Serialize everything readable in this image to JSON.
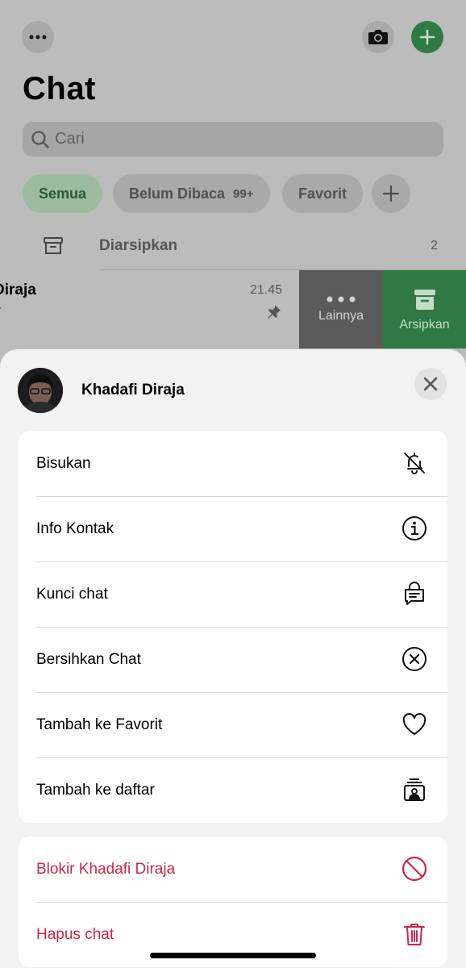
{
  "header": {
    "title": "Chat"
  },
  "search": {
    "placeholder": "Cari"
  },
  "filters": [
    {
      "label": "Semua",
      "active": true
    },
    {
      "label": "Belum Dibaca",
      "count": "99+"
    },
    {
      "label": "Favorit"
    }
  ],
  "archived": {
    "label": "Diarsipkan",
    "count": "2"
  },
  "chat": {
    "name": "Diraja",
    "preview": "r",
    "time": "21.45"
  },
  "swipe": {
    "more_label": "Lainnya",
    "archive_label": "Arsipkan"
  },
  "sheet": {
    "contact_name": "Khadafi Diraja",
    "menu": [
      {
        "label": "Bisukan",
        "icon": "bell-slash-icon"
      },
      {
        "label": "Info Kontak",
        "icon": "info-icon"
      },
      {
        "label": "Kunci chat",
        "icon": "lock-chat-icon"
      },
      {
        "label": "Bersihkan Chat",
        "icon": "clear-x-icon"
      },
      {
        "label": "Tambah ke Favorit",
        "icon": "heart-icon"
      },
      {
        "label": "Tambah ke daftar",
        "icon": "list-contact-icon"
      }
    ],
    "danger": [
      {
        "label": "Blokir Khadafi Diraja",
        "icon": "block-icon"
      },
      {
        "label": "Hapus chat",
        "icon": "trash-icon"
      }
    ]
  },
  "colors": {
    "accent": "#2f7a44",
    "danger": "#c8294a",
    "sheet_bg": "#f2f2f2"
  }
}
